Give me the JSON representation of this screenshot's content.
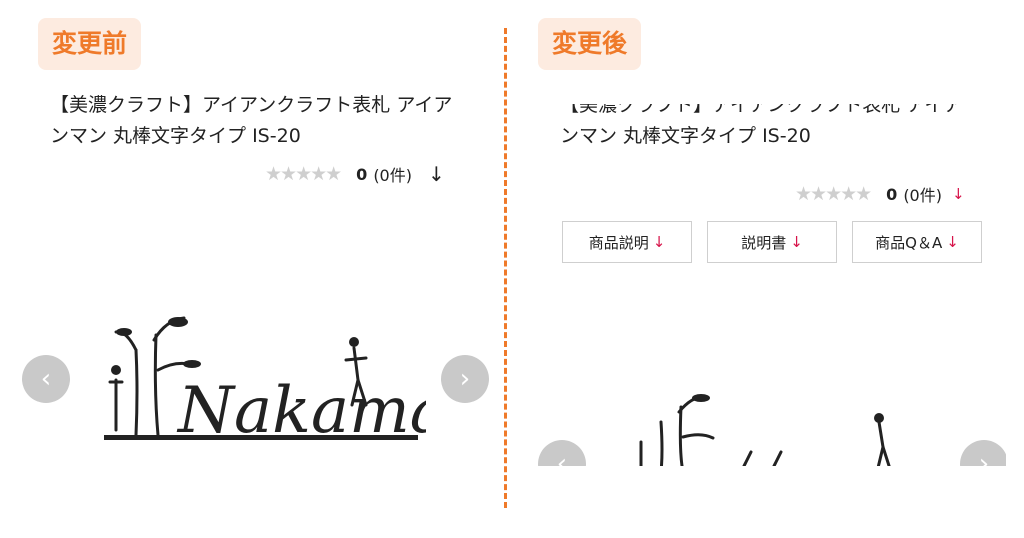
{
  "before": {
    "badge": "変更前",
    "title_line1": "【美濃クラフト】アイアンクラフト表札 アイア",
    "title_line2": "ンマン 丸棒文字タイプ IS-20",
    "rating": {
      "stars": "★★★★★",
      "score": "0",
      "count": "(0件)",
      "arrow": "↓"
    },
    "image_text": "Nakama"
  },
  "after": {
    "badge": "変更後",
    "title_line1": "【美濃クラフト】アイアンクラフト表札 アイア",
    "title_line2": "ンマン 丸棒文字タイプ IS-20",
    "rating": {
      "stars": "★★★★★",
      "score": "0",
      "count": "(0件)",
      "arrow": "↓"
    },
    "buttons": [
      {
        "label": "商品説明",
        "arrow": "↓"
      },
      {
        "label": "説明書",
        "arrow": "↓"
      },
      {
        "label": "商品Q＆A",
        "arrow": "↓"
      }
    ]
  },
  "icons": {
    "prev": "chevron-left-icon",
    "next": "chevron-right-icon"
  },
  "colors": {
    "accent": "#ef7a2a",
    "badge_bg": "#fdebe0",
    "red_arrow": "#d7144a",
    "star": "#cfcfcf",
    "nav_bg": "#c9c9c9"
  }
}
